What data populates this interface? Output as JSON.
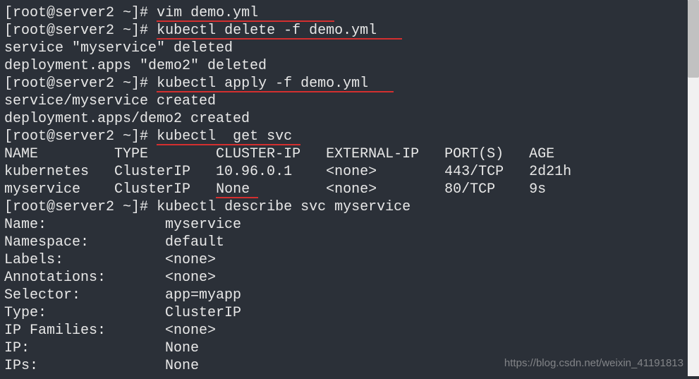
{
  "prompt": "[root@server2 ~]#",
  "commands": {
    "cmd1": "vim demo.yml",
    "cmd1_u": "vim demo.yml         ",
    "cmd2_u": "kubectl delete -f demo.yml   ",
    "cmd3_u": "kubectl apply -f demo.yml   ",
    "cmd4": "kubectl  get svc",
    "cmd4_u": "kubectl  get svc ",
    "cmd5": "kubectl describe svc myservice"
  },
  "output": {
    "delete1": "service \"myservice\" deleted",
    "delete2": "deployment.apps \"demo2\" deleted",
    "apply1": "service/myservice created",
    "apply2": "deployment.apps/demo2 created"
  },
  "svc_table": {
    "headers": "NAME         TYPE        CLUSTER-IP   EXTERNAL-IP   PORT(S)   AGE",
    "row1": "kubernetes   ClusterIP   10.96.0.1    <none>        443/TCP   2d21h",
    "row2_a": "myservice    ClusterIP   ",
    "row2_none": "None ",
    "row2_b": "        <none>        80/TCP    9s"
  },
  "describe": {
    "name": "Name:              myservice",
    "namespace": "Namespace:         default",
    "labels": "Labels:            <none>",
    "annotations": "Annotations:       <none>",
    "selector": "Selector:          app=myapp",
    "type": "Type:              ClusterIP",
    "ipfamilies": "IP Families:       <none>",
    "ip": "IP:                None",
    "ips": "IPs:               None"
  },
  "watermark": "https://blog.csdn.net/weixin_41191813"
}
